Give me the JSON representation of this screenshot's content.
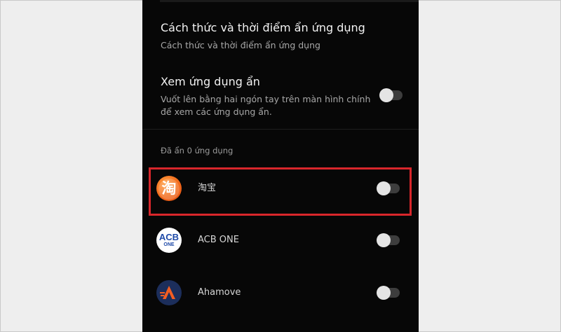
{
  "settings": {
    "how_when_title": "Cách thức và thời điểm ẩn ứng dụng",
    "how_when_sub": "Cách thức và thời điểm ẩn ứng dụng",
    "view_hidden_title": "Xem ứng dụng ẩn",
    "view_hidden_desc": "Vuốt lên bằng hai ngón tay trên màn hình chính để xem các ứng dụng ẩn.",
    "view_hidden_enabled": false
  },
  "hidden_section": {
    "label": "Đã ẩn 0 ứng dụng"
  },
  "apps": [
    {
      "name": "淘宝",
      "icon": "taobao-icon",
      "hidden": false
    },
    {
      "name": "ACB ONE",
      "icon": "acb-one-icon",
      "hidden": false
    },
    {
      "name": "Ahamove",
      "icon": "ahamove-icon",
      "hidden": false
    }
  ],
  "icon_text": {
    "taobao": "淘",
    "acb_top": "ACB",
    "acb_bottom": "ONE"
  },
  "colors": {
    "screen_bg": "#070707",
    "page_bg": "#efefef",
    "highlight": "#d8262b",
    "taobao_orange": "#f26a1b",
    "acb_blue": "#1e4aa8",
    "ahamove_navy": "#1c2e5b",
    "ahamove_orange": "#f25d22"
  }
}
